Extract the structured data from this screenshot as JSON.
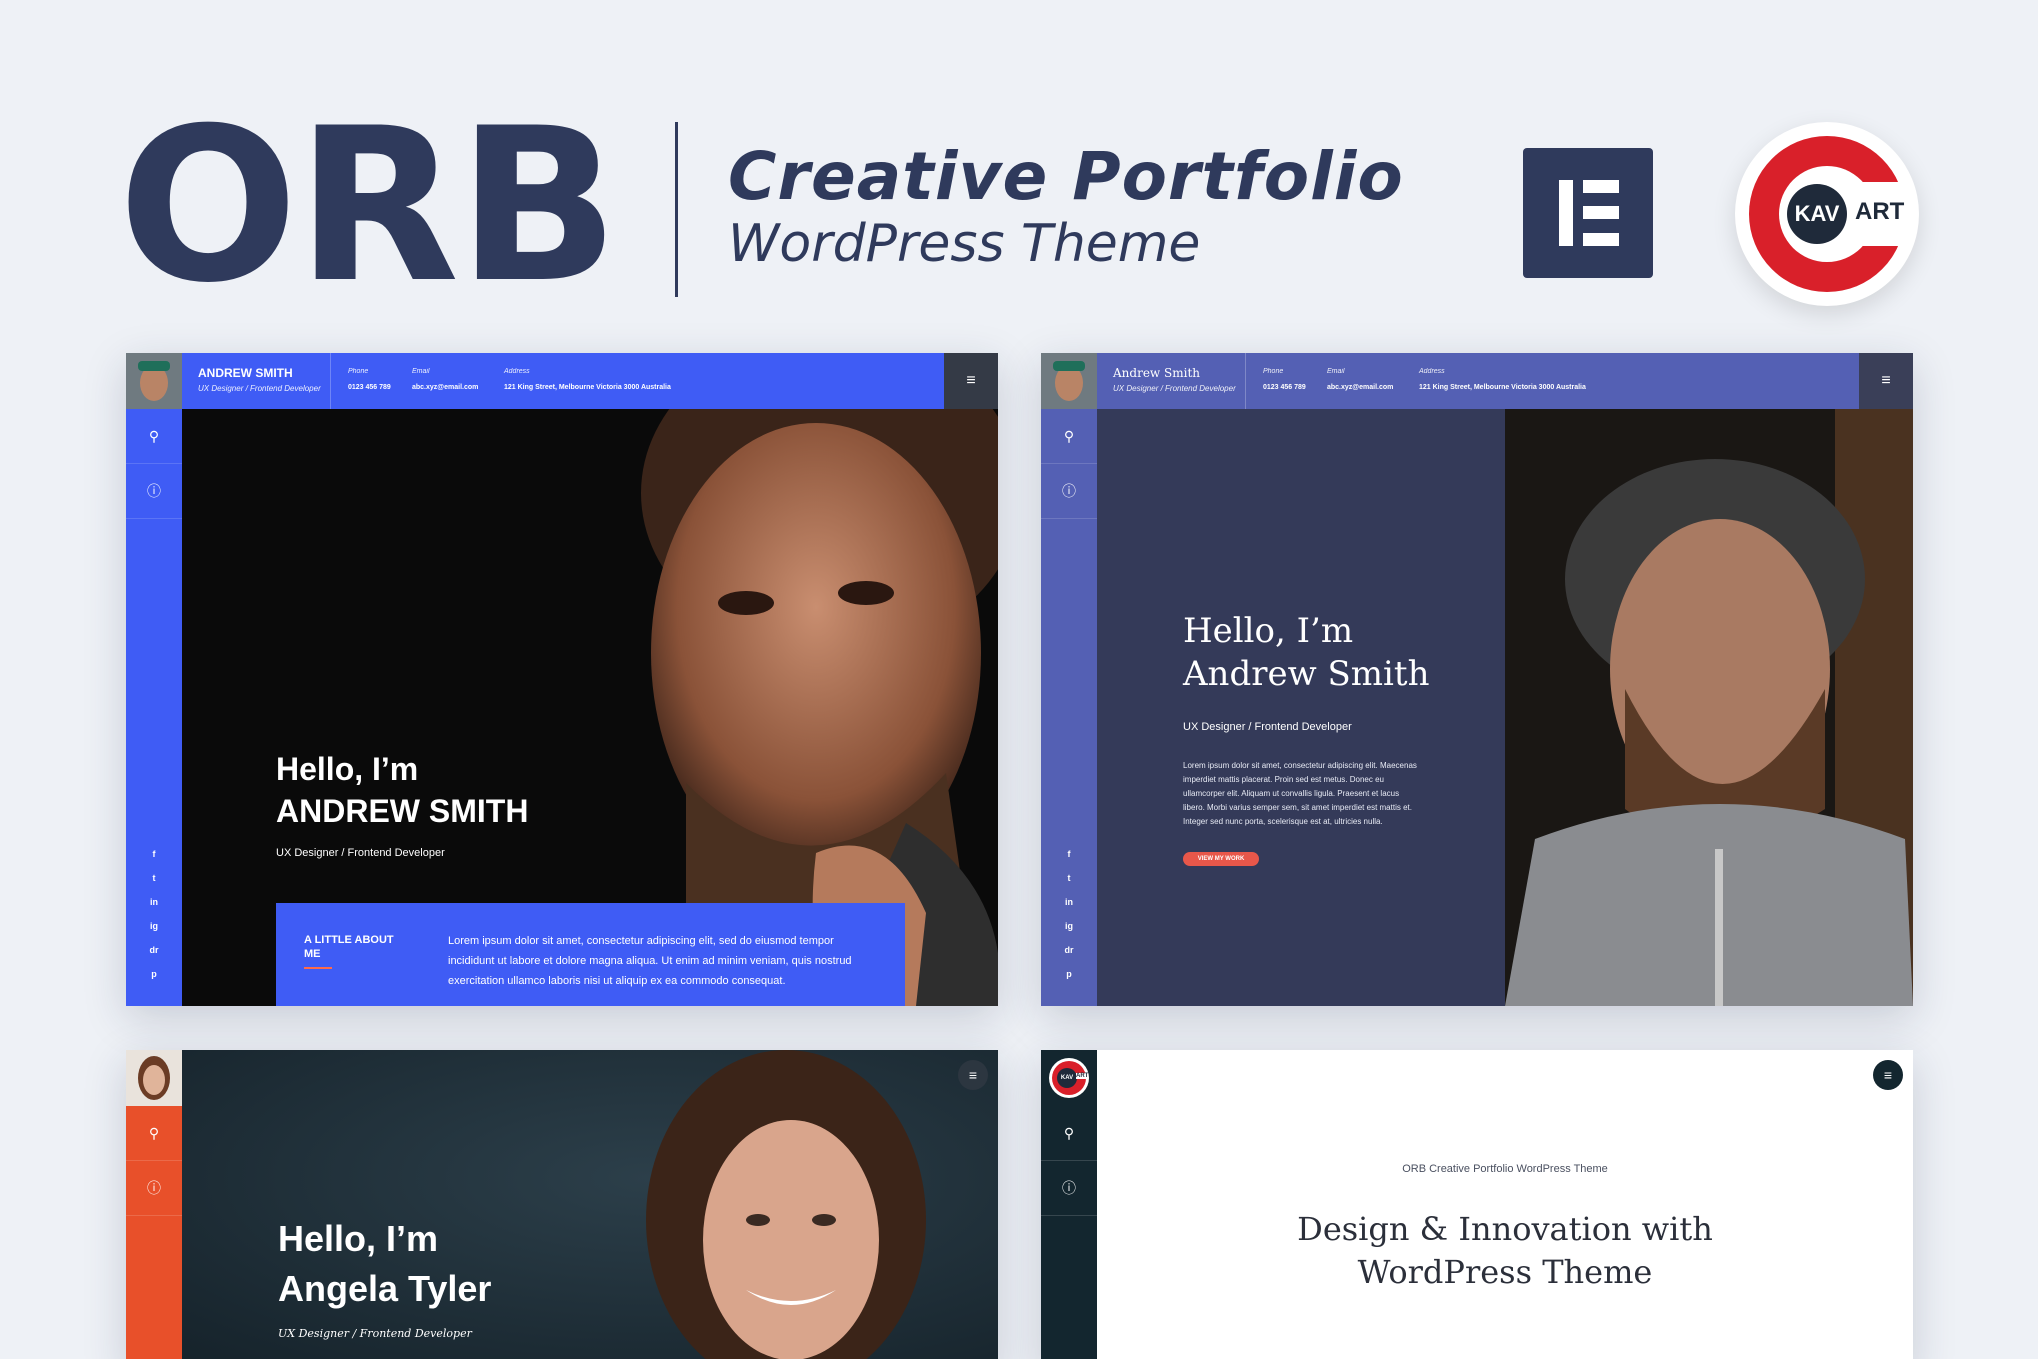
{
  "header": {
    "logo": "ORB",
    "title": "Creative Portfolio",
    "subtitle": "WordPress Theme",
    "kav_left": "KAV",
    "kav_right": "ART"
  },
  "colors": {
    "navy": "#2f3a5c",
    "blue": "#3f5cf5",
    "indigo": "#5460b4",
    "orange": "#e8502a",
    "red": "#d9202a",
    "coral": "#e8574a"
  },
  "demo1": {
    "name": "ANDREW SMITH",
    "role": "UX Designer / Frontend Developer",
    "phone_label": "Phone",
    "phone": "0123 456 789",
    "email_label": "Email",
    "email": "abc.xyz@email.com",
    "address_label": "Address",
    "address": "121 King Street, Melbourne Victoria 3000 Australia",
    "menu": "≡",
    "hello": "Hello, I’m",
    "hero_name": "ANDREW SMITH",
    "hero_role": "UX Designer / Frontend Developer",
    "about_heading": "A LITTLE ABOUT ME",
    "about_text": "Lorem ipsum dolor sit amet, consectetur adipiscing elit, sed do eiusmod tempor incididunt ut labore et dolore magna aliqua. Ut enim ad minim veniam, quis nostrud exercitation ullamco laboris nisi ut aliquip ex ea commodo consequat.",
    "social": [
      "f",
      "t",
      "in",
      "ig",
      "dr",
      "p"
    ]
  },
  "demo2": {
    "name": "Andrew Smith",
    "role": "UX Designer / Frontend Developer",
    "phone_label": "Phone",
    "phone": "0123 456 789",
    "email_label": "Email",
    "email": "abc.xyz@email.com",
    "address_label": "Address",
    "address": "121 King Street, Melbourne Victoria 3000 Australia",
    "menu": "≡",
    "hello": "Hello, I’m",
    "hero_name": "Andrew Smith",
    "hero_role": "UX Designer / Frontend Developer",
    "lorem": "Lorem ipsum dolor sit amet, consectetur adipiscing elit. Maecenas imperdiet mattis placerat. Proin sed est metus. Donec eu ullamcorper elit. Aliquam ut convallis ligula. Praesent et lacus libero. Morbi varius semper sem, sit amet imperdiet est mattis et. Integer sed nunc porta, scelerisque est at, ultricies nulla.",
    "cta": "VIEW MY WORK",
    "social": [
      "f",
      "t",
      "in",
      "ig",
      "dr",
      "p"
    ]
  },
  "demo3": {
    "menu": "≡",
    "hello": "Hello, I’m",
    "hero_name": "Angela Tyler",
    "hero_role": "UX Designer / Frontend Developer"
  },
  "demo4": {
    "menu": "≡",
    "kav_left": "KAV",
    "kav_right": "ART",
    "eyebrow": "ORB Creative Portfolio WordPress Theme",
    "headline_1": "Design & Innovation with",
    "headline_2": "WordPress Theme"
  }
}
